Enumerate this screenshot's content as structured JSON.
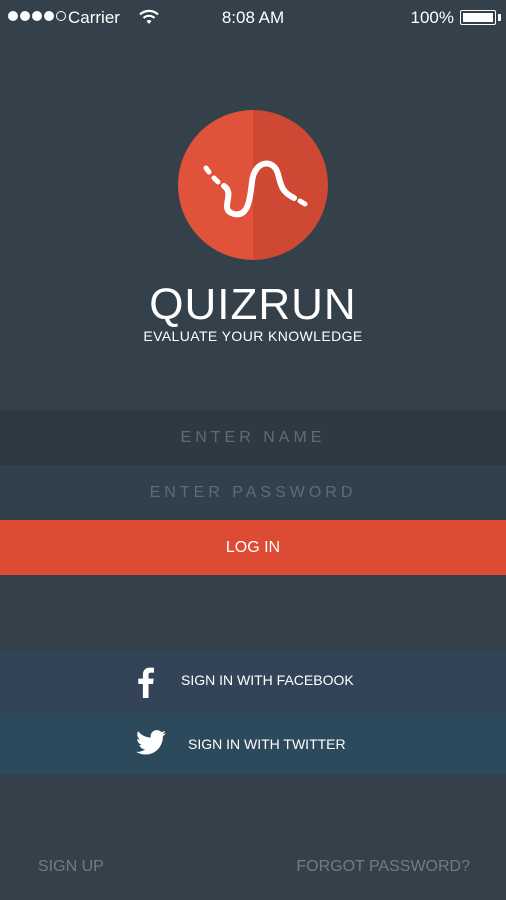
{
  "status_bar": {
    "carrier": "Carrier",
    "time": "8:08 AM",
    "battery": "100%",
    "signal_bars_filled": 4,
    "signal_bars_total": 5
  },
  "app": {
    "title": "QUIZRUN",
    "subtitle": "EVALUATE YOUR KNOWLEDGE",
    "logo_icon": "winding-path-icon"
  },
  "form": {
    "name_placeholder": "ENTER NAME",
    "password_placeholder": "ENTER PASSWORD",
    "login_label": "LOG IN"
  },
  "social": {
    "facebook_label": "SIGN IN WITH FACEBOOK",
    "twitter_label": "SIGN IN WITH TWITTER"
  },
  "footer": {
    "sign_up": "SIGN UP",
    "forgot_password": "FORGOT PASSWORD?"
  },
  "colors": {
    "background": "#34414b",
    "accent": "#dd4b35",
    "facebook_row": "#344458",
    "twitter_row": "#2d4a5d"
  }
}
